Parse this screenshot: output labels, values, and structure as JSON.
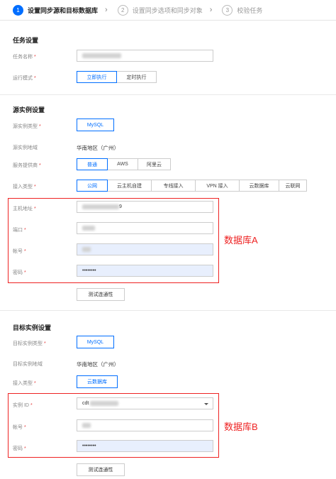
{
  "steps": [
    {
      "num": "1",
      "label": "设置同步源和目标数据库",
      "active": true
    },
    {
      "num": "2",
      "label": "设置同步选项和同步对象",
      "active": false
    },
    {
      "num": "3",
      "label": "校验任务",
      "active": false
    }
  ],
  "step_separator": "›",
  "task_settings": {
    "title": "任务设置",
    "task_name_label": "任务名称",
    "run_mode_label": "运行模式",
    "run_mode_options": [
      "立即执行",
      "定时执行"
    ],
    "run_mode_selected": "立即执行"
  },
  "source": {
    "title": "源实例设置",
    "instance_type_label": "源实例类型",
    "instance_type_value": "MySQL",
    "region_label": "源实例地域",
    "region_value": "华南地区（广州）",
    "provider_label": "服务提供商",
    "provider_options": [
      "普通",
      "AWS",
      "阿里云"
    ],
    "provider_selected": "普通",
    "access_label": "接入类型",
    "access_options": [
      "公网",
      "云主机自建",
      "专线接入",
      "VPN 接入",
      "云数据库",
      "云联网"
    ],
    "access_selected": "公网",
    "host_label": "主机地址",
    "host_visible_suffix": "9",
    "port_label": "端口",
    "account_label": "帐号",
    "password_label": "密码",
    "password_value": "••••••••",
    "test_button": "测试连通性",
    "annotation": "数据库A"
  },
  "target": {
    "title": "目标实例设置",
    "instance_type_label": "目标实例类型",
    "instance_type_value": "MySQL",
    "region_label": "目标实例地域",
    "region_value": "华南地区（广州）",
    "access_label": "接入类型",
    "access_value": "云数据库",
    "instance_id_label": "实例 ID",
    "instance_id_prefix": "cdt",
    "account_label": "帐号",
    "password_label": "密码",
    "password_value": "••••••••",
    "test_button": "测试连通性",
    "annotation": "数据库B"
  },
  "required_mark": "*",
  "colors": {
    "accent": "#006eff",
    "annotation": "#e22222",
    "filled_input": "#e8effd"
  }
}
